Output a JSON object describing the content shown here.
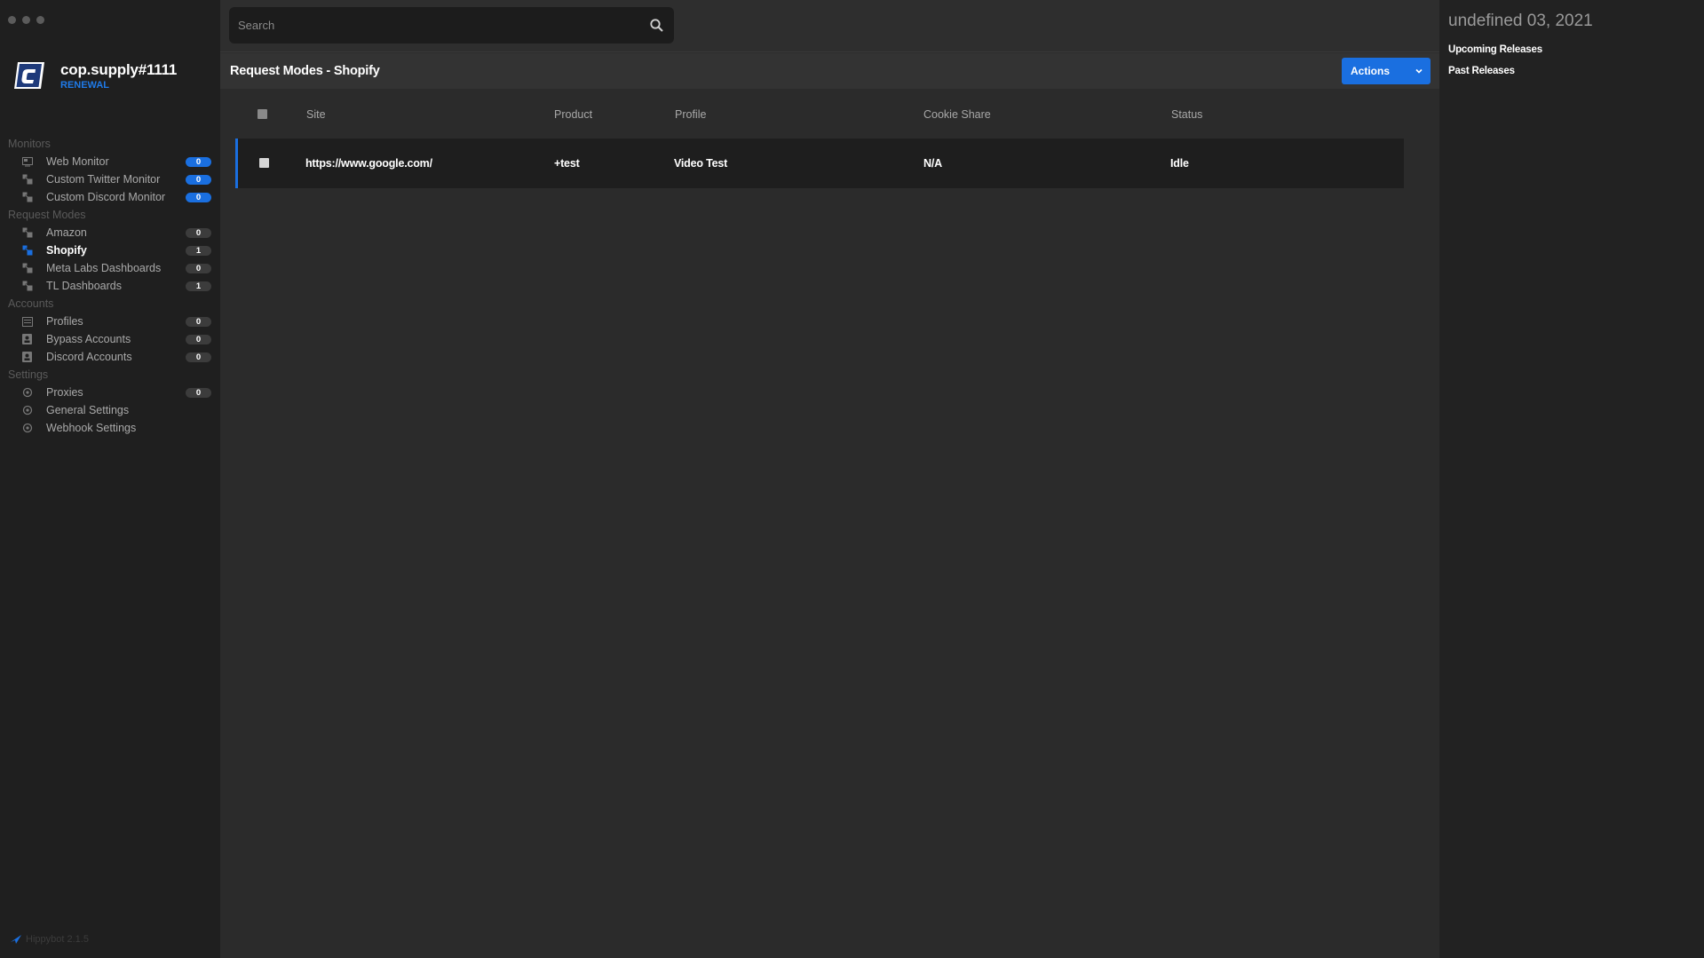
{
  "app": {
    "user_name": "cop.supply#1111",
    "user_status": "RENEWAL",
    "version": "Hippybot 2.1.5"
  },
  "search": {
    "placeholder": "Search",
    "value": ""
  },
  "sidebar": {
    "sections": [
      {
        "title": "Monitors",
        "items": [
          {
            "label": "Web Monitor",
            "count": "0",
            "icon": "monitor-icon",
            "badge_color": "blue"
          },
          {
            "label": "Custom Twitter Monitor",
            "count": "0",
            "icon": "task-icon",
            "badge_color": "blue"
          },
          {
            "label": "Custom Discord Monitor",
            "count": "0",
            "icon": "task-icon",
            "badge_color": "blue"
          }
        ]
      },
      {
        "title": "Request Modes",
        "items": [
          {
            "label": "Amazon",
            "count": "0",
            "icon": "task-icon"
          },
          {
            "label": "Shopify",
            "count": "1",
            "icon": "task-icon",
            "active": true
          },
          {
            "label": "Meta Labs Dashboards",
            "count": "0",
            "icon": "task-icon"
          },
          {
            "label": "TL Dashboards",
            "count": "1",
            "icon": "task-icon"
          }
        ]
      },
      {
        "title": "Accounts",
        "items": [
          {
            "label": "Profiles",
            "count": "0",
            "icon": "profile-card-icon"
          },
          {
            "label": "Bypass Accounts",
            "count": "0",
            "icon": "account-icon"
          },
          {
            "label": "Discord Accounts",
            "count": "0",
            "icon": "account-icon"
          }
        ]
      },
      {
        "title": "Settings",
        "items": [
          {
            "label": "Proxies",
            "count": "0",
            "icon": "gear-icon"
          },
          {
            "label": "General Settings",
            "icon": "gear-icon"
          },
          {
            "label": "Webhook Settings",
            "icon": "gear-icon"
          }
        ]
      }
    ]
  },
  "main": {
    "title": "Request Modes - Shopify",
    "actions_label": "Actions",
    "table": {
      "columns": [
        "Site",
        "Product",
        "Profile",
        "Cookie Share",
        "Status"
      ],
      "rows": [
        {
          "site": "https://www.google.com/",
          "product": "+test",
          "profile": "Video Test",
          "cookie_share": "N/A",
          "status": "Idle"
        }
      ]
    }
  },
  "right_panel": {
    "date": "undefined 03, 2021",
    "links": [
      "Upcoming Releases",
      "Past Releases"
    ]
  },
  "colors": {
    "accent": "#1a6fe0",
    "sidebar_bg": "#1f1f1f",
    "main_bg": "#2b2b2b",
    "panel_bg": "#222222"
  }
}
